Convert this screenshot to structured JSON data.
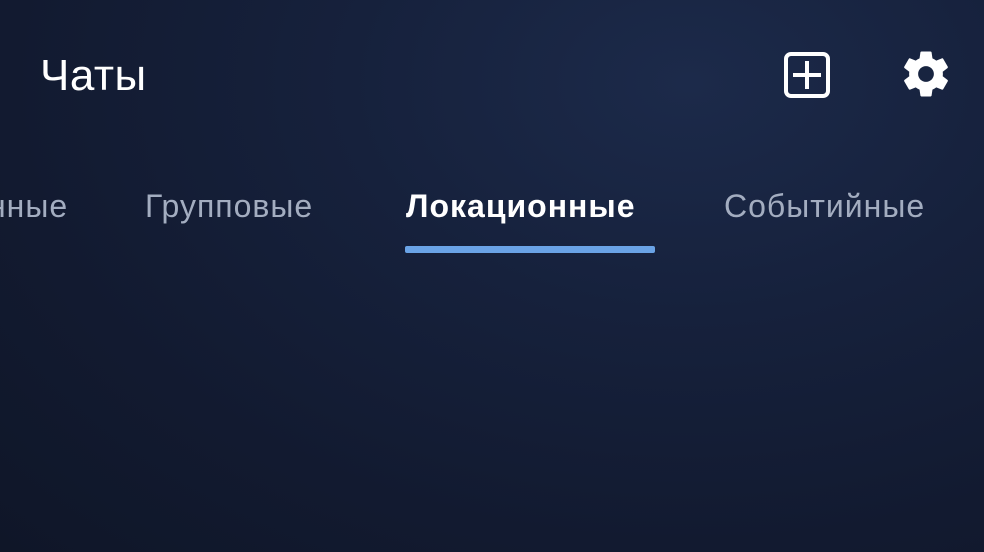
{
  "header": {
    "title": "Чаты",
    "add_icon": "plus-square-icon",
    "settings_icon": "gear-icon"
  },
  "tabs": [
    {
      "label": "нные",
      "active": false
    },
    {
      "label": "Групповые",
      "active": false
    },
    {
      "label": "Локационные",
      "active": true
    },
    {
      "label": "Событийные",
      "active": false
    }
  ],
  "colors": {
    "background": "#141d35",
    "accent": "#6aa3e6",
    "inactive_tab": "#a3adc0",
    "active_tab": "#ffffff"
  }
}
